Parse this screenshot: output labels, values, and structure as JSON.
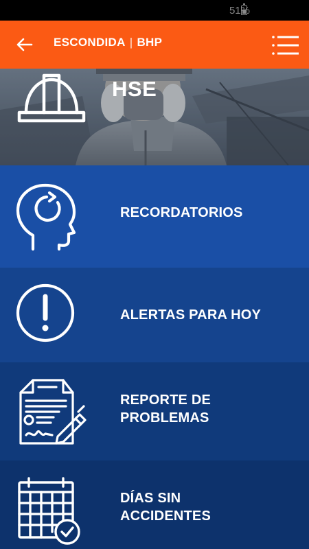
{
  "status_bar": {
    "battery_text": "51%"
  },
  "app_bar": {
    "title_left": "ESCONDIDA",
    "title_sep": "|",
    "title_right": "BHP",
    "color": "#fb5a14"
  },
  "hero": {
    "title": "HSE"
  },
  "menu": [
    {
      "label": "RECORDATORIOS",
      "icon": "head-refresh-icon",
      "color": "#1a4fa6"
    },
    {
      "label": "ALERTAS PARA HOY",
      "icon": "alert-circle-icon",
      "color": "#15448e"
    },
    {
      "label_line1": "REPORTE DE",
      "label_line2": "PROBLEMAS",
      "icon": "report-document-icon",
      "color": "#103a7b"
    },
    {
      "label_line1": "DÍAS SIN",
      "label_line2": "ACCIDENTES",
      "icon": "calendar-check-icon",
      "color": "#0d326c"
    }
  ]
}
